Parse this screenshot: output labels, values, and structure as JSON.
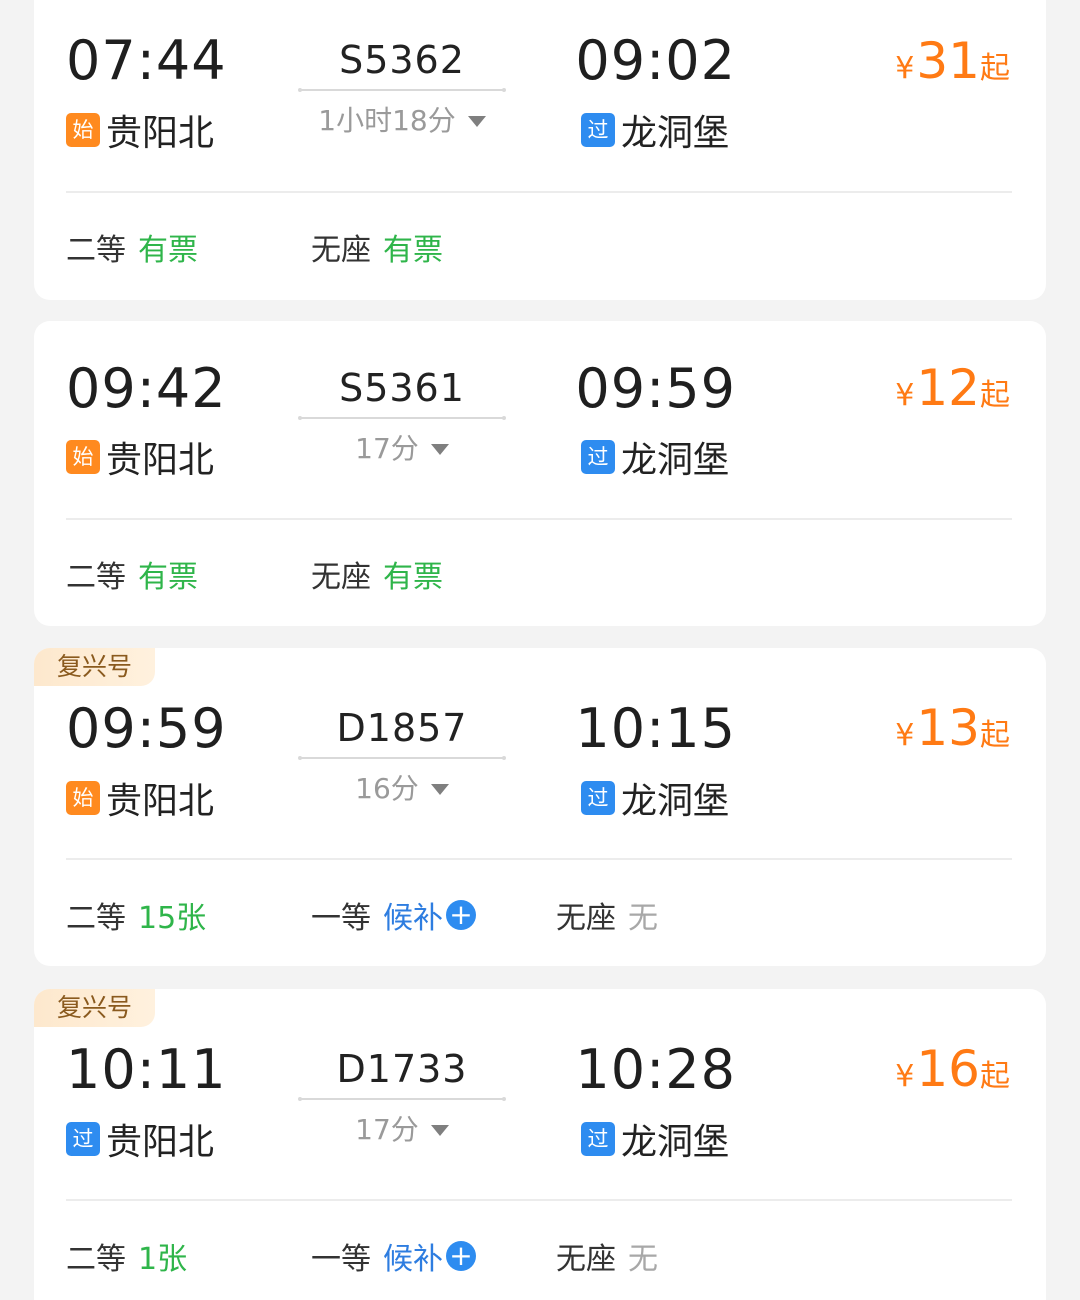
{
  "trains": [
    {
      "tag": "",
      "dep_time": "07:44",
      "dep_badge": "始",
      "dep_station": "贵阳北",
      "train_no": "S5362",
      "duration": "1小时18分",
      "arr_time": "09:02",
      "arr_badge": "过",
      "arr_station": "龙洞堡",
      "price_symbol": "¥",
      "price": "31",
      "price_suffix": "起",
      "seats": [
        {
          "label": "二等",
          "status": "有票"
        },
        {
          "label": "无座",
          "status": "有票"
        }
      ]
    },
    {
      "tag": "",
      "dep_time": "09:42",
      "dep_badge": "始",
      "dep_station": "贵阳北",
      "train_no": "S5361",
      "duration": "17分",
      "arr_time": "09:59",
      "arr_badge": "过",
      "arr_station": "龙洞堡",
      "price_symbol": "¥",
      "price": "12",
      "price_suffix": "起",
      "seats": [
        {
          "label": "二等",
          "status": "有票"
        },
        {
          "label": "无座",
          "status": "有票"
        }
      ]
    },
    {
      "tag": "复兴号",
      "dep_time": "09:59",
      "dep_badge": "始",
      "dep_station": "贵阳北",
      "train_no": "D1857",
      "duration": "16分",
      "arr_time": "10:15",
      "arr_badge": "过",
      "arr_station": "龙洞堡",
      "price_symbol": "¥",
      "price": "13",
      "price_suffix": "起",
      "seats": [
        {
          "label": "二等",
          "status": "15张"
        },
        {
          "label": "一等",
          "status": "候补"
        },
        {
          "label": "无座",
          "status": "无"
        }
      ]
    },
    {
      "tag": "复兴号",
      "dep_time": "10:11",
      "dep_badge": "过",
      "dep_station": "贵阳北",
      "train_no": "D1733",
      "duration": "17分",
      "arr_time": "10:28",
      "arr_badge": "过",
      "arr_station": "龙洞堡",
      "price_symbol": "¥",
      "price": "16",
      "price_suffix": "起",
      "seats": [
        {
          "label": "二等",
          "status": "1张"
        },
        {
          "label": "一等",
          "status": "候补"
        },
        {
          "label": "无座",
          "status": "无"
        }
      ]
    }
  ],
  "colors": {
    "start_badge": "#ff8a1f",
    "pass_badge": "#2e8cf0",
    "price": "#ff7a14",
    "available": "#2fb54a",
    "waitlist": "#2e7de0",
    "unavailable": "#a8a8a8"
  },
  "icons": {
    "expand": "caret-down-icon",
    "waitlist_add": "plus-circle-icon"
  },
  "waitlist_plus_glyph": "+"
}
